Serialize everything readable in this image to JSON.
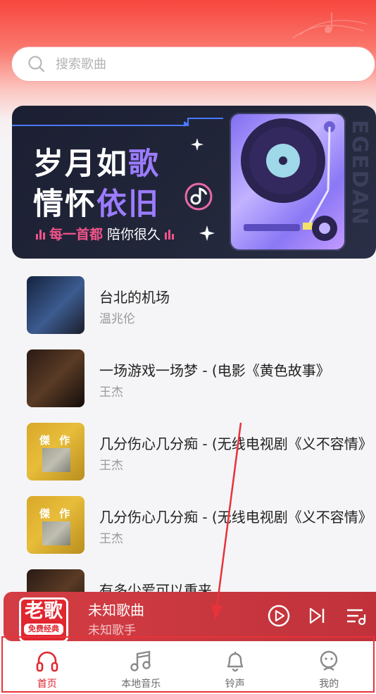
{
  "search": {
    "placeholder": "搜索歌曲"
  },
  "banner": {
    "line1_a": "岁月如",
    "line1_b": "歌",
    "line2_a": "情怀",
    "line2_b": "依旧",
    "sub_a": "每一首都",
    "sub_b": "陪你很久",
    "vertical": "EGEDAN"
  },
  "songs": [
    {
      "title": "台北的机场",
      "artist": "温兆伦"
    },
    {
      "title": "一场游戏一场梦 - (电影《黄色故事》",
      "artist": "王杰"
    },
    {
      "title": "几分伤心几分痴 - (无线电视剧《义不容情》",
      "artist": "王杰",
      "cover_text": "傑 作"
    },
    {
      "title": "几分伤心几分痴 - (无线电视剧《义不容情》",
      "artist": "王杰",
      "cover_text": "傑 作"
    },
    {
      "title": "有多少爱可以重来",
      "artist": ""
    }
  ],
  "player": {
    "logo_big": "老歌",
    "logo_small": "免费经典",
    "title": "未知歌曲",
    "artist": "未知歌手"
  },
  "tabs": [
    {
      "label": "首页",
      "icon": "headphones-icon",
      "active": true
    },
    {
      "label": "本地音乐",
      "icon": "music-note-icon",
      "active": false
    },
    {
      "label": "铃声",
      "icon": "bell-icon",
      "active": false
    },
    {
      "label": "我的",
      "icon": "profile-icon",
      "active": false
    }
  ],
  "colors": {
    "accent": "#e0262f",
    "player": "#cf3940"
  }
}
